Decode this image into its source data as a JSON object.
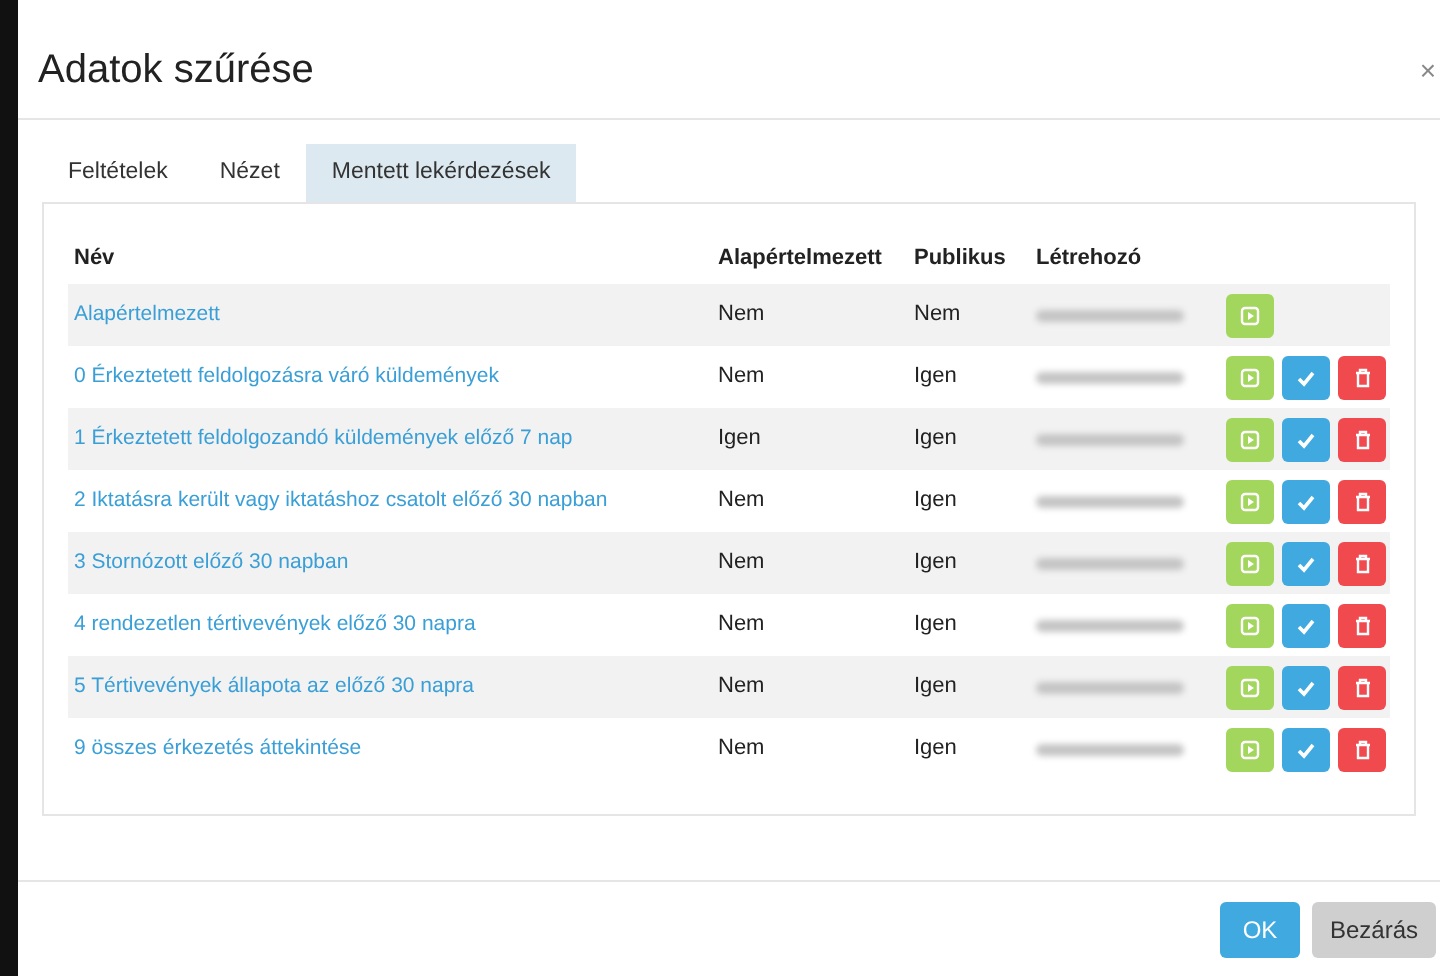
{
  "dialog": {
    "title": "Adatok szűrése",
    "close": "×"
  },
  "tabs": [
    {
      "label": "Feltételek",
      "selected": false
    },
    {
      "label": "Nézet",
      "selected": false
    },
    {
      "label": "Mentett lekérdezések",
      "selected": true
    }
  ],
  "table": {
    "columns": [
      "Név",
      "Alapértelmezett",
      "Publikus",
      "Létrehozó"
    ],
    "rows": [
      {
        "name": "Alapértelmezett",
        "default": "Nem",
        "public": "Nem",
        "actions": [
          {
            "kind": "run"
          }
        ]
      },
      {
        "name": "0 Érkeztetett feldolgozásra váró küldemények",
        "default": "Nem",
        "public": "Igen",
        "actions": [
          {
            "kind": "run"
          },
          {
            "kind": "apply"
          },
          {
            "kind": "delete"
          }
        ]
      },
      {
        "name": "1 Érkeztetett feldolgozandó küldemények előző 7 nap",
        "default": "Igen",
        "public": "Igen",
        "actions": [
          {
            "kind": "run"
          },
          {
            "kind": "apply"
          },
          {
            "kind": "delete"
          }
        ]
      },
      {
        "name": "2 Iktatásra került vagy iktatáshoz csatolt előző 30 napban",
        "default": "Nem",
        "public": "Igen",
        "actions": [
          {
            "kind": "run"
          },
          {
            "kind": "apply"
          },
          {
            "kind": "delete"
          }
        ]
      },
      {
        "name": "3 Stornózott előző 30 napban",
        "default": "Nem",
        "public": "Igen",
        "actions": [
          {
            "kind": "run"
          },
          {
            "kind": "apply"
          },
          {
            "kind": "delete"
          }
        ]
      },
      {
        "name": "4 rendezetlen tértivevények előző 30 napra",
        "default": "Nem",
        "public": "Igen",
        "actions": [
          {
            "kind": "run"
          },
          {
            "kind": "apply"
          },
          {
            "kind": "delete"
          }
        ]
      },
      {
        "name": "5 Tértivevények állapota az előző 30 napra",
        "default": "Nem",
        "public": "Igen",
        "actions": [
          {
            "kind": "run"
          },
          {
            "kind": "apply"
          },
          {
            "kind": "delete"
          }
        ]
      },
      {
        "name": "9 összes érkezetés áttekintése",
        "default": "Nem",
        "public": "Igen",
        "actions": [
          {
            "kind": "run"
          },
          {
            "kind": "apply"
          },
          {
            "kind": "delete"
          }
        ]
      }
    ]
  },
  "buttons": {
    "ok": "OK",
    "close": "Bezárás"
  }
}
